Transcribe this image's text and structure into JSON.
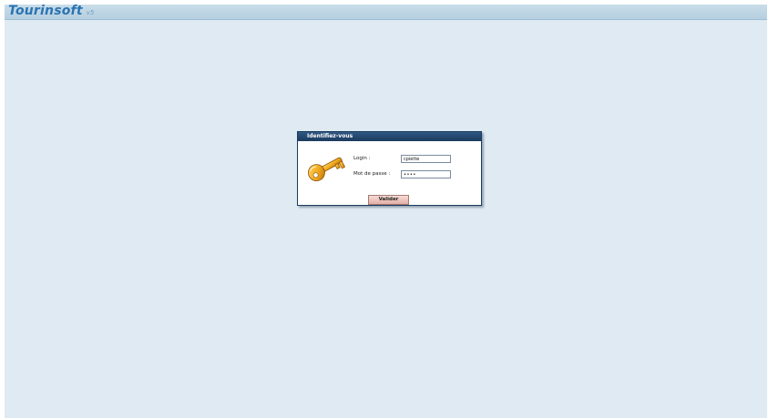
{
  "app": {
    "brand": "Tourinsoft",
    "version": "v5"
  },
  "dialog": {
    "title": "Identifiez-vous",
    "key_icon": "key-icon",
    "login_label": "Login :",
    "login_value": "cpiette",
    "password_label": "Mot de passe :",
    "password_value": "••••",
    "submit_label": "Valider"
  },
  "colors": {
    "background": "#dfeaf2",
    "header": "#c9dde9",
    "brand": "#2a74b3",
    "dialog_title": "#1c3a5e",
    "button": "#e9bcb4"
  }
}
